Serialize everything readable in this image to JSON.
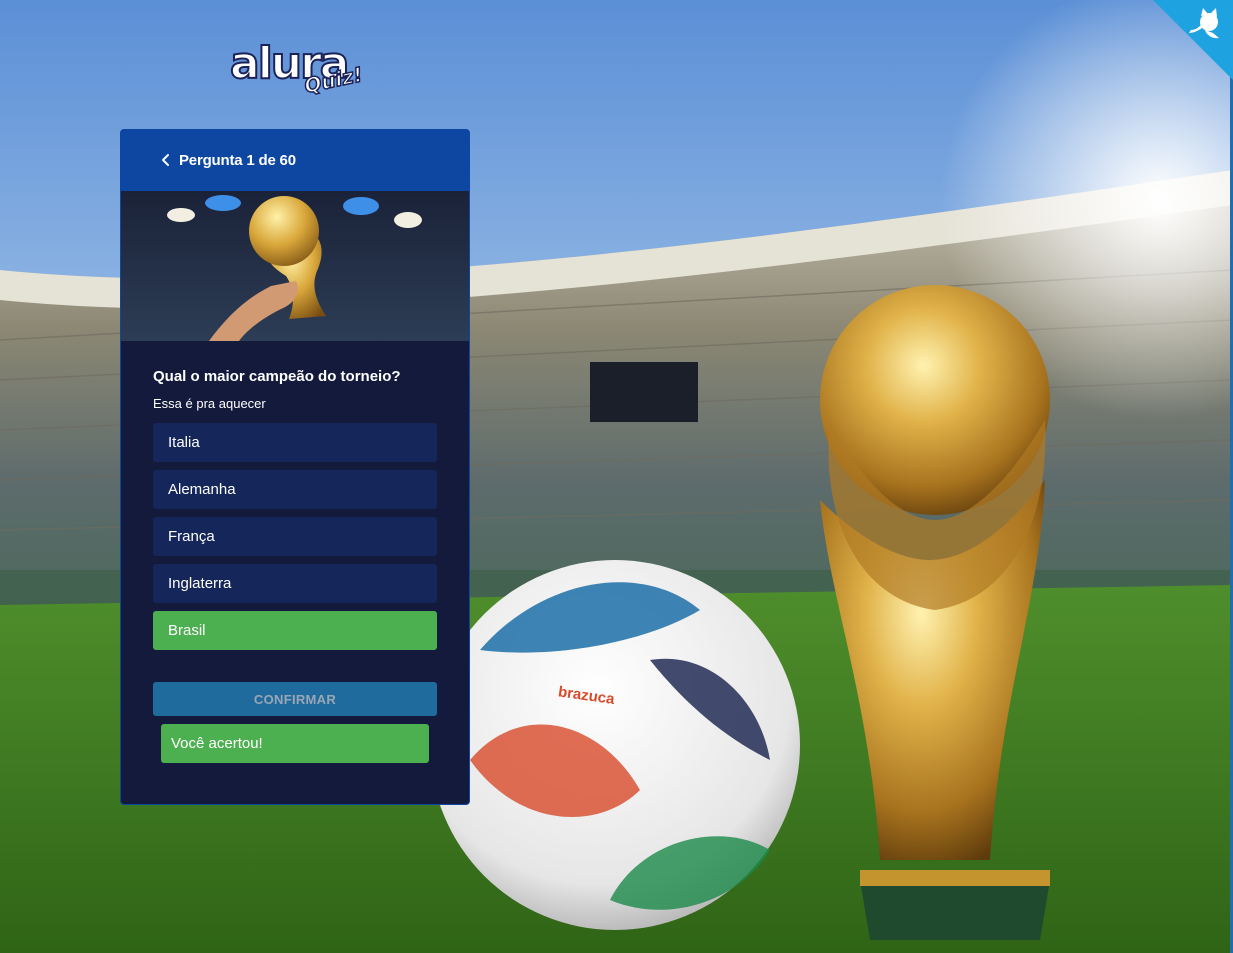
{
  "colors": {
    "primary": "#0d47a1",
    "card_background": "#141a3b",
    "option_background": "#15265a",
    "success": "#4caf50",
    "confirm_button": "#1f6b9e"
  },
  "logo": {
    "main": "alura",
    "sub": "Quiz!"
  },
  "github_corner": {
    "icon": "octocat-icon"
  },
  "quiz": {
    "header_icon": "chevron-left-icon",
    "header_title": "Pergunta 1 de 60",
    "question": "Qual o maior campeão do torneio?",
    "description": "Essa é pra aquecer",
    "options": [
      "Italia",
      "Alemanha",
      "França",
      "Inglaterra",
      "Brasil"
    ],
    "selected_option": "Brasil",
    "confirm_label": "CONFIRMAR",
    "result_message": "Você acertou!"
  },
  "background": {
    "ball_brand": "brazuca"
  }
}
